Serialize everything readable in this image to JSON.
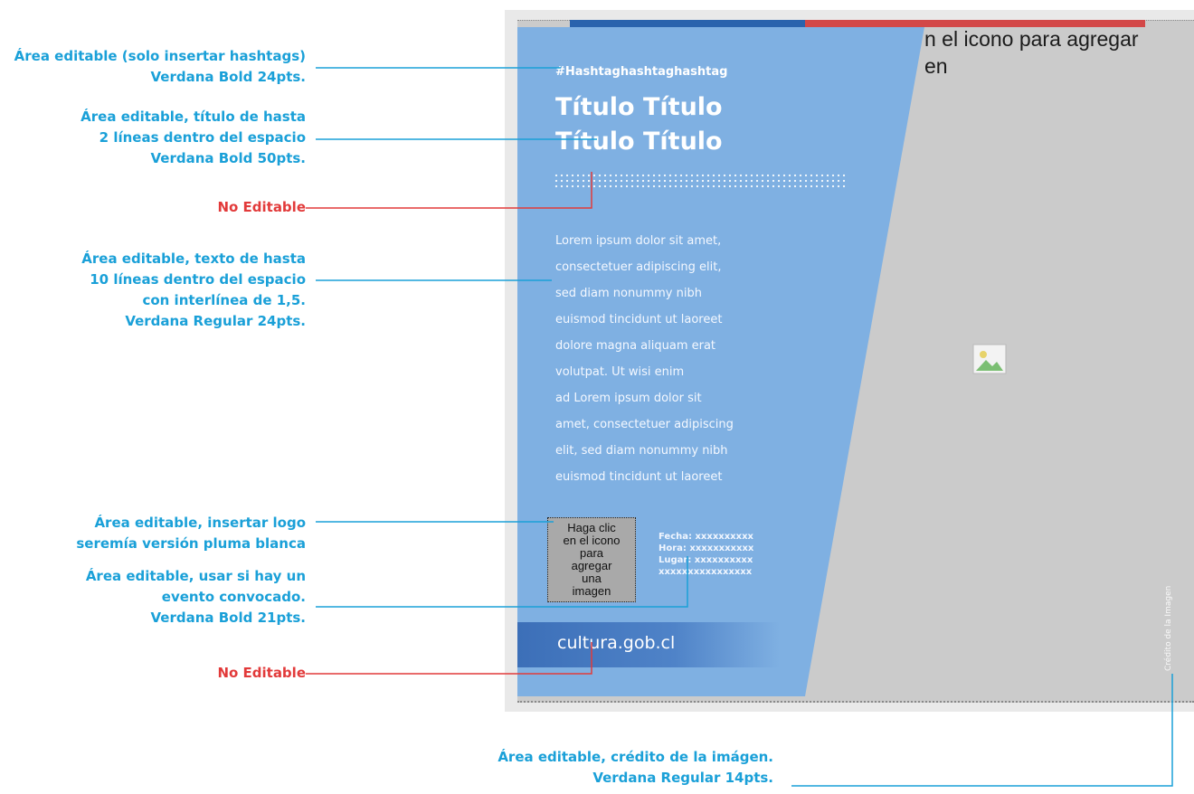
{
  "annotations": [
    {
      "id": "hashtag",
      "color": "blue",
      "lines": [
        "Área editable (solo insertar hashtags)",
        "Verdana Bold 24pts."
      ]
    },
    {
      "id": "title",
      "color": "blue",
      "lines": [
        "Área editable, título de hasta",
        "2 líneas dentro del espacio",
        "Verdana Bold 50pts."
      ]
    },
    {
      "id": "noedit1",
      "color": "red",
      "lines": [
        "No Editable"
      ]
    },
    {
      "id": "text",
      "color": "blue",
      "lines": [
        "Área editable, texto de hasta",
        "10 líneas dentro del espacio",
        "con interlínea de 1,5.",
        "Verdana Regular 24pts."
      ]
    },
    {
      "id": "logo",
      "color": "blue",
      "lines": [
        "Área editable, insertar logo",
        "seremía versión pluma blanca"
      ]
    },
    {
      "id": "event",
      "color": "blue",
      "lines": [
        "Área editable, usar si hay un",
        "evento convocado.",
        "Verdana Bold 21pts."
      ]
    },
    {
      "id": "noedit2",
      "color": "red",
      "lines": [
        "No Editable"
      ]
    }
  ],
  "credit_annotation": {
    "lines": [
      "Área editable, crédito de la imágen.",
      "Verdana Regular 14pts."
    ]
  },
  "colors": {
    "blue": "#1aa0d8",
    "red": "#e23a3a",
    "panel": "#7fb0e2",
    "dark_blue": "#2a63ad"
  },
  "poster": {
    "image_placeholder_lines": [
      "n el icono para agregar",
      "en"
    ],
    "hashtag": "#Hashtaghashtaghashtag",
    "title_lines": [
      "Título Título",
      "Título Título"
    ],
    "body_lines": [
      "Lorem ipsum dolor sit amet,",
      "consectetuer adipiscing elit,",
      "sed diam nonummy nibh",
      "euismod tincidunt ut laoreet",
      "dolore magna aliquam erat",
      "volutpat. Ut wisi enim",
      "ad Lorem ipsum dolor sit",
      "amet, consectetuer adipiscing",
      "elit, sed diam nonummy nibh",
      "euismod tincidunt ut laoreet"
    ],
    "logo_placeholder_lines": [
      "Haga clic",
      "en el icono",
      "para",
      "agregar",
      "una",
      "imagen"
    ],
    "event_lines": [
      "Fecha: xxxxxxxxxx",
      "Hora: xxxxxxxxxxx",
      "Lugar: xxxxxxxxxx",
      "xxxxxxxxxxxxxxxx"
    ],
    "footer": "cultura.gob.cl",
    "credit": "Crédito de la Imagen"
  }
}
